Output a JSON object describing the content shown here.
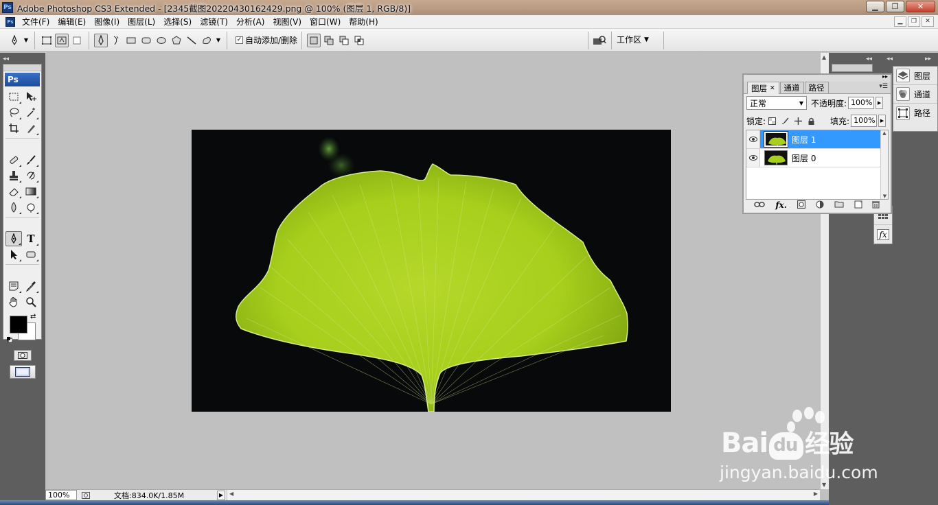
{
  "window": {
    "title": "Adobe Photoshop CS3 Extended - [2345截图20220430162429.png @ 100% (图层 1, RGB/8)]",
    "app_logo": "Ps",
    "buttons": {
      "minimize": "▁",
      "maximize": "❐",
      "close": "✕"
    }
  },
  "menubar": {
    "items": [
      "文件(F)",
      "编辑(E)",
      "图像(I)",
      "图层(L)",
      "选择(S)",
      "滤镜(T)",
      "分析(A)",
      "视图(V)",
      "窗口(W)",
      "帮助(H)"
    ]
  },
  "options_bar": {
    "auto_add_delete_label": "自动添加/删除",
    "auto_add_delete_checked": true,
    "workspace_label": "工作区"
  },
  "toolbox": {
    "logo": "Ps",
    "type_tool_glyph": "T"
  },
  "status": {
    "zoom": "100%",
    "doc_info": "文档:834.0K/1.85M"
  },
  "dock": {
    "layers_label": "图层",
    "channels_label": "通道",
    "paths_label": "路径"
  },
  "layers_panel": {
    "tabs": [
      "图层",
      "通道",
      "路径"
    ],
    "active_tab": "图层",
    "blend_mode": "正常",
    "opacity_label": "不透明度:",
    "opacity_value": "100%",
    "lock_label": "锁定:",
    "fill_label": "填充:",
    "fill_value": "100%",
    "layers": [
      {
        "name": "图层 1",
        "active": true
      },
      {
        "name": "图层 0",
        "active": false
      }
    ]
  },
  "colors": {
    "foreground": "#000000",
    "background": "#ffffff",
    "selection": "#3399ff",
    "leaf": "#a7cf1c"
  },
  "watermark": {
    "brand": "Bai",
    "brand_suffix": "经验",
    "url": "jingyan.baidu.com"
  }
}
